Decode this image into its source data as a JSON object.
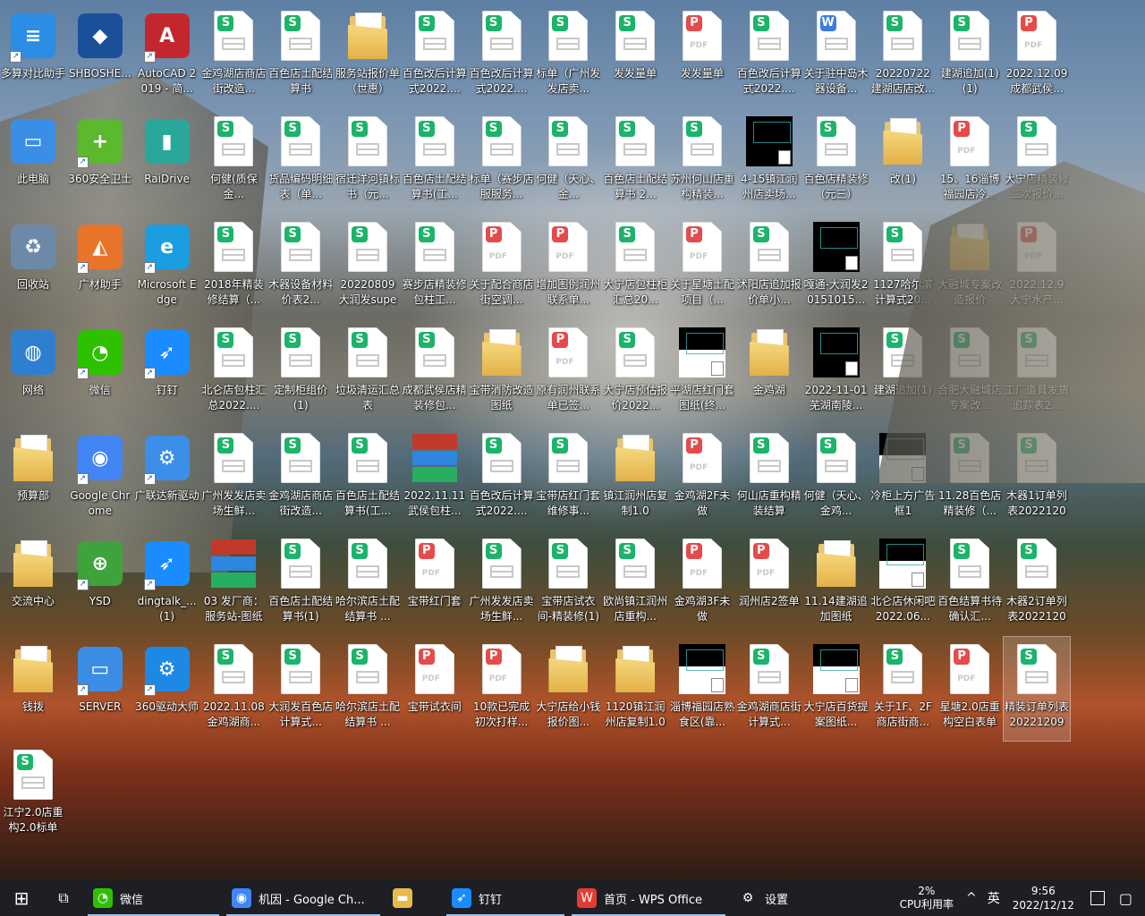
{
  "desktop": {
    "icons": [
      {
        "label": "多算对比助手",
        "kind": "app",
        "color": "#2b8de3",
        "glyph": "≡",
        "col": 0,
        "row": 0,
        "shortcut": true
      },
      {
        "label": "SHBOSHE...",
        "kind": "app",
        "color": "#1a4f9a",
        "glyph": "◆",
        "col": 1,
        "row": 0,
        "shortcut": false
      },
      {
        "label": "AutoCAD 2019 - 简...",
        "kind": "app",
        "color": "#c3262d",
        "glyph": "A",
        "col": 2,
        "row": 0,
        "shortcut": true
      },
      {
        "label": "金鸡湖店商店街改造...",
        "kind": "xls",
        "col": 3,
        "row": 0
      },
      {
        "label": "百色店土配结算书",
        "kind": "xls",
        "col": 4,
        "row": 0
      },
      {
        "label": "服务站报价单（世惠）",
        "kind": "folder",
        "col": 5,
        "row": 0
      },
      {
        "label": "百色改后计算式2022....",
        "kind": "xls",
        "col": 6,
        "row": 0
      },
      {
        "label": "百色改后计算式2022....",
        "kind": "xls",
        "col": 7,
        "row": 0
      },
      {
        "label": "标单（广州发发店卖...",
        "kind": "xls",
        "col": 8,
        "row": 0
      },
      {
        "label": "发发量单",
        "kind": "xls",
        "col": 9,
        "row": 0
      },
      {
        "label": "发发量单",
        "kind": "pdf",
        "col": 10,
        "row": 0
      },
      {
        "label": "百色改后计算式2022....",
        "kind": "xls",
        "col": 11,
        "row": 0
      },
      {
        "label": "关于驻中岛木器设备...",
        "kind": "doc",
        "col": 12,
        "row": 0
      },
      {
        "label": "20220722建湖店店改...",
        "kind": "xls",
        "col": 13,
        "row": 0
      },
      {
        "label": "建湖追加(1)(1)",
        "kind": "xls",
        "col": 14,
        "row": 0
      },
      {
        "label": "2022.12.09成都武侯...",
        "kind": "pdf",
        "col": 15,
        "row": 0
      },
      {
        "label": "此电脑",
        "kind": "app",
        "color": "#3a8ee6",
        "glyph": "▭",
        "col": 0,
        "row": 1,
        "shortcut": false
      },
      {
        "label": "360安全卫士",
        "kind": "app",
        "color": "#5cb82c",
        "glyph": "+",
        "col": 1,
        "row": 1,
        "shortcut": true
      },
      {
        "label": "RaiDrive",
        "kind": "app",
        "color": "#2aa79b",
        "glyph": "▮",
        "col": 2,
        "row": 1,
        "shortcut": false
      },
      {
        "label": "何健(质保金...",
        "kind": "xls",
        "col": 3,
        "row": 1
      },
      {
        "label": "货品编码明细表（单...",
        "kind": "xls",
        "col": 4,
        "row": 1
      },
      {
        "label": "宿迁洋河镇标书（元...",
        "kind": "xls",
        "col": 5,
        "row": 1
      },
      {
        "label": "百色店土配结算书(工...",
        "kind": "xls",
        "col": 6,
        "row": 1
      },
      {
        "label": "标单（赛步店服服务...",
        "kind": "xls",
        "col": 7,
        "row": 1
      },
      {
        "label": "何健（天心、金...",
        "kind": "xls",
        "col": 8,
        "row": 1
      },
      {
        "label": "百色店土配结算书 2...",
        "kind": "xls",
        "col": 9,
        "row": 1
      },
      {
        "label": "苏州何山店重构精装...",
        "kind": "xls",
        "col": 10,
        "row": 1
      },
      {
        "label": "4-15镇江润州店卖场...",
        "kind": "dwg",
        "col": 11,
        "row": 1
      },
      {
        "label": "百色店精装修（元三）",
        "kind": "xls",
        "col": 12,
        "row": 1
      },
      {
        "label": "改(1)",
        "kind": "folder",
        "col": 13,
        "row": 1
      },
      {
        "label": "15、16淄博福园店冷...",
        "kind": "pdf",
        "col": 14,
        "row": 1
      },
      {
        "label": "大宁店精装修二次报价...",
        "kind": "xls",
        "col": 15,
        "row": 1
      },
      {
        "label": "回收站",
        "kind": "app",
        "color": "#6c8aa8",
        "glyph": "♻",
        "col": 0,
        "row": 2,
        "shortcut": false
      },
      {
        "label": "广材助手",
        "kind": "app",
        "color": "#e8742a",
        "glyph": "◭",
        "col": 1,
        "row": 2,
        "shortcut": true
      },
      {
        "label": "Microsoft Edge",
        "kind": "app",
        "color": "#1b9de2",
        "glyph": "e",
        "col": 2,
        "row": 2,
        "shortcut": true
      },
      {
        "label": "2018年精装修结算（...",
        "kind": "xls",
        "col": 3,
        "row": 2
      },
      {
        "label": "木器设备材料价表2...",
        "kind": "xls",
        "col": 4,
        "row": 2
      },
      {
        "label": "20220809大润发super...",
        "kind": "xls",
        "col": 5,
        "row": 2
      },
      {
        "label": "赛步店精装修包柱工...",
        "kind": "xls",
        "col": 6,
        "row": 2
      },
      {
        "label": "关于配合商店街空调...",
        "kind": "pdf",
        "col": 7,
        "row": 2
      },
      {
        "label": "增加图例润州联系单...",
        "kind": "pdf",
        "col": 8,
        "row": 2
      },
      {
        "label": "大宁店包柱柜汇总20...",
        "kind": "xls",
        "col": 9,
        "row": 2
      },
      {
        "label": "关于星塘土配项目（...",
        "kind": "pdf",
        "col": 10,
        "row": 2
      },
      {
        "label": "沭阳店追加报价单小...",
        "kind": "xls",
        "col": 11,
        "row": 2
      },
      {
        "label": "嘎通-大润发20151015...",
        "kind": "dwg",
        "col": 12,
        "row": 2
      },
      {
        "label": "1127哈尔滨计算式20...",
        "kind": "xls",
        "col": 13,
        "row": 2
      },
      {
        "label": "大融城专案改造报价",
        "kind": "folder",
        "col": 14,
        "row": 2
      },
      {
        "label": "2022.12.9大宁水产...",
        "kind": "pdf",
        "col": 15,
        "row": 2
      },
      {
        "label": "网络",
        "kind": "app",
        "color": "#2f7fd1",
        "glyph": "◍",
        "col": 0,
        "row": 3,
        "shortcut": false
      },
      {
        "label": "微信",
        "kind": "app",
        "color": "#2dc100",
        "glyph": "◔",
        "col": 1,
        "row": 3,
        "shortcut": true
      },
      {
        "label": "钉钉",
        "kind": "app",
        "color": "#1a8cff",
        "glyph": "➶",
        "col": 2,
        "row": 3,
        "shortcut": true
      },
      {
        "label": "北仑店包柱汇总2022....",
        "kind": "xls",
        "col": 3,
        "row": 3
      },
      {
        "label": "定制柜组价(1)",
        "kind": "xls",
        "col": 4,
        "row": 3
      },
      {
        "label": "垃圾清运汇总表",
        "kind": "xls",
        "col": 5,
        "row": 3
      },
      {
        "label": "成都武侯店精装修包...",
        "kind": "xls",
        "col": 6,
        "row": 3
      },
      {
        "label": "宝带消防改造图纸",
        "kind": "folder",
        "col": 7,
        "row": 3
      },
      {
        "label": "原有润州联系单已签...",
        "kind": "pdf",
        "col": 8,
        "row": 3
      },
      {
        "label": "大宁店预估报价2022...",
        "kind": "xls",
        "col": 9,
        "row": 3
      },
      {
        "label": "平湖店红门套图纸(终...",
        "kind": "dwgw",
        "col": 10,
        "row": 3
      },
      {
        "label": "金鸡湖",
        "kind": "folder",
        "col": 11,
        "row": 3
      },
      {
        "label": "2022-11-01芜湖南陵...",
        "kind": "dwg",
        "col": 12,
        "row": 3
      },
      {
        "label": "建湖追加(1)",
        "kind": "xls",
        "col": 13,
        "row": 3
      },
      {
        "label": "合肥大融城店专案改...",
        "kind": "xls",
        "col": 14,
        "row": 3
      },
      {
        "label": "工厂道具发货追踪表2...",
        "kind": "xls",
        "col": 15,
        "row": 3
      },
      {
        "label": "预算部",
        "kind": "folder",
        "col": 0,
        "row": 4
      },
      {
        "label": "Google Chrome",
        "kind": "app",
        "color": "#4285f4",
        "glyph": "◉",
        "col": 1,
        "row": 4,
        "shortcut": true
      },
      {
        "label": "广联达新驱动",
        "kind": "app",
        "color": "#3b8fe8",
        "glyph": "⚙",
        "col": 2,
        "row": 4,
        "shortcut": true
      },
      {
        "label": "广州发发店卖场生鲜...",
        "kind": "xls",
        "col": 3,
        "row": 4
      },
      {
        "label": "金鸡湖店商店街改造...",
        "kind": "xls",
        "col": 4,
        "row": 4
      },
      {
        "label": "百色店土配结算书(工...",
        "kind": "xls",
        "col": 5,
        "row": 4
      },
      {
        "label": "2022.11.11武侯包柱...",
        "kind": "rar",
        "col": 6,
        "row": 4
      },
      {
        "label": "百色改后计算式2022....",
        "kind": "xls",
        "col": 7,
        "row": 4
      },
      {
        "label": "宝带店红门套维修事...",
        "kind": "xls",
        "col": 8,
        "row": 4
      },
      {
        "label": "镇江润州店复制1.0",
        "kind": "folder",
        "col": 9,
        "row": 4
      },
      {
        "label": "金鸡湖2F未做",
        "kind": "pdf",
        "col": 10,
        "row": 4
      },
      {
        "label": "何山店重构精装结算",
        "kind": "xls",
        "col": 11,
        "row": 4
      },
      {
        "label": "何健（天心、金鸡...",
        "kind": "xls",
        "col": 12,
        "row": 4
      },
      {
        "label": "冷柜上方广告框1",
        "kind": "dwgw",
        "col": 13,
        "row": 4
      },
      {
        "label": "11.28百色店精装修（...",
        "kind": "xls",
        "col": 14,
        "row": 4
      },
      {
        "label": "木器1订单列表20221209",
        "kind": "xls",
        "col": 15,
        "row": 4
      },
      {
        "label": "交流中心",
        "kind": "folder",
        "col": 0,
        "row": 5
      },
      {
        "label": "YSD",
        "kind": "app",
        "color": "#3fa33c",
        "glyph": "⊕",
        "col": 1,
        "row": 5,
        "shortcut": true
      },
      {
        "label": "dingtalk_...(1)",
        "kind": "app",
        "color": "#1a8cff",
        "glyph": "➶",
        "col": 2,
        "row": 5,
        "shortcut": true
      },
      {
        "label": "03 发厂商：服务站-图纸",
        "kind": "rar",
        "col": 3,
        "row": 5
      },
      {
        "label": "百色店土配结算书(1)",
        "kind": "xls",
        "col": 4,
        "row": 5
      },
      {
        "label": "哈尔滨店土配结算书 ...",
        "kind": "xls",
        "col": 5,
        "row": 5
      },
      {
        "label": "宝带红门套",
        "kind": "pdf",
        "col": 6,
        "row": 5
      },
      {
        "label": "广州发发店卖场生鲜...",
        "kind": "xls",
        "col": 7,
        "row": 5
      },
      {
        "label": "宝带店试衣间-精装修(1)",
        "kind": "xls",
        "col": 8,
        "row": 5
      },
      {
        "label": "欧尚镇江润州店重构...",
        "kind": "xls",
        "col": 9,
        "row": 5
      },
      {
        "label": "金鸡湖3F未做",
        "kind": "pdf",
        "col": 10,
        "row": 5
      },
      {
        "label": "润州店2签单",
        "kind": "pdf",
        "col": 11,
        "row": 5
      },
      {
        "label": "11.14建湖追加图纸",
        "kind": "folder",
        "col": 12,
        "row": 5
      },
      {
        "label": "北仑店休闲吧2022.06...",
        "kind": "dwgw",
        "col": 13,
        "row": 5
      },
      {
        "label": "百色结算书待确认汇...",
        "kind": "xls",
        "col": 14,
        "row": 5
      },
      {
        "label": "木器2订单列表20221209",
        "kind": "xls",
        "col": 15,
        "row": 5
      },
      {
        "label": "钱拨",
        "kind": "folder",
        "col": 0,
        "row": 6
      },
      {
        "label": "SERVER",
        "kind": "app",
        "color": "#3a8ee6",
        "glyph": "▭",
        "col": 1,
        "row": 6,
        "shortcut": true
      },
      {
        "label": "360驱动大师",
        "kind": "app",
        "color": "#1e88e5",
        "glyph": "⚙",
        "col": 2,
        "row": 6,
        "shortcut": true
      },
      {
        "label": "2022.11.08金鸡湖商...",
        "kind": "xls",
        "col": 3,
        "row": 6
      },
      {
        "label": "大润发百色店计算式...",
        "kind": "xls",
        "col": 4,
        "row": 6
      },
      {
        "label": "哈尔滨店土配结算书 ...",
        "kind": "xls",
        "col": 5,
        "row": 6
      },
      {
        "label": "宝带试衣间",
        "kind": "pdf",
        "col": 6,
        "row": 6
      },
      {
        "label": "10款已完成初次打样...",
        "kind": "pdf",
        "col": 7,
        "row": 6
      },
      {
        "label": "大宁店给小钱报价图...",
        "kind": "folder",
        "col": 8,
        "row": 6
      },
      {
        "label": "1120镇江润州店复制1.0",
        "kind": "folder",
        "col": 9,
        "row": 6
      },
      {
        "label": "淄博福园店熟食区(靠...",
        "kind": "dwgw",
        "col": 10,
        "row": 6
      },
      {
        "label": "金鸡湖商店街计算式...",
        "kind": "xls",
        "col": 11,
        "row": 6
      },
      {
        "label": "大宁店百货提案图纸...",
        "kind": "dwgw",
        "col": 12,
        "row": 6
      },
      {
        "label": "关于1F、2F商店街商...",
        "kind": "xls",
        "col": 13,
        "row": 6
      },
      {
        "label": "星塘2.0店重构空白表单",
        "kind": "pdf",
        "col": 14,
        "row": 6
      },
      {
        "label": "精装订单列表20221209",
        "kind": "xls",
        "col": 15,
        "row": 6,
        "selected": true
      },
      {
        "label": "江宁2.0店重构2.0标单",
        "kind": "xls",
        "col": 0,
        "row": 7
      }
    ]
  },
  "taskbar": {
    "start_label": "⊞",
    "taskview_label": "⧉",
    "apps": [
      {
        "label": "微信",
        "icon": "wechat-icon",
        "color": "#2dc100",
        "glyph": "◔",
        "active": true
      },
      {
        "label": "机因 - Google Ch...",
        "icon": "chrome-icon",
        "color": "#4285f4",
        "glyph": "◉",
        "active": true
      },
      {
        "label": "",
        "icon": "file-explorer-icon",
        "color": "#e9b949",
        "glyph": "▬",
        "active": false
      },
      {
        "label": "钉钉",
        "icon": "dingtalk-icon",
        "color": "#1a8cff",
        "glyph": "➶",
        "active": true
      },
      {
        "label": "首页 - WPS Office",
        "icon": "wps-icon",
        "color": "#e43b32",
        "glyph": "W",
        "active": true
      },
      {
        "label": "设置",
        "icon": "gear-icon",
        "color": "#1d1f24",
        "glyph": "⚙",
        "active": false
      }
    ],
    "cpu_percent": "2%",
    "cpu_label": "CPU利用率",
    "tray_chevron": "^",
    "ime": "英",
    "time": "9:56",
    "date": "2022/12/12",
    "notification_glyph": "▢"
  }
}
